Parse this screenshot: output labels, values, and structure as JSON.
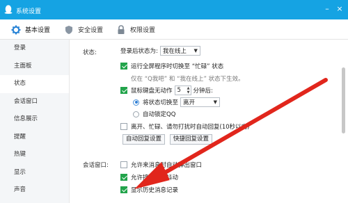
{
  "window": {
    "title": "系统设置",
    "minimize": "–",
    "close": "×"
  },
  "tabs": [
    {
      "label": "基本设置",
      "icon": "gear-icon",
      "active": true
    },
    {
      "label": "安全设置",
      "icon": "shield-icon",
      "active": false
    },
    {
      "label": "权限设置",
      "icon": "lock-icon",
      "active": false
    }
  ],
  "sidebar": {
    "items": [
      {
        "label": "登录"
      },
      {
        "label": "主面板"
      },
      {
        "label": "状态",
        "active": true
      },
      {
        "label": "会话窗口"
      },
      {
        "label": "信息展示"
      },
      {
        "label": "提醒"
      },
      {
        "label": "热键"
      },
      {
        "label": "显示"
      },
      {
        "label": "声音"
      }
    ]
  },
  "status": {
    "section_label": "状态:",
    "login_status_label": "登录后状态为:",
    "login_status_value": "我在线上",
    "fullscreen_busy": {
      "label": "运行全屏程序时切换至 “忙碌” 状态",
      "checked": true
    },
    "hint": "仅在 “Q我吧” 和 “我在线上” 状态下生效。",
    "idle": {
      "label": "鼠标键盘无动作",
      "checked": true,
      "minutes": "5",
      "minutes_suffix": "分钟后:"
    },
    "radio_switch": {
      "label": "将状态切换至",
      "value": "离开",
      "selected": true
    },
    "radio_lock": {
      "label": "自动锁定QQ",
      "selected": false
    },
    "auto_reply": {
      "label": "离开、忙碌、请勿打扰时自动回复(10秒以内)",
      "checked": false
    },
    "auto_reply_settings_btn": "自动回复设置",
    "quick_reply_settings_btn": "快捷回复设置"
  },
  "chat_window": {
    "section_label": "会话窗口:",
    "options": [
      {
        "label": "允许来消息时自动弹出窗口",
        "checked": false
      },
      {
        "label": "允许接收窗口抖动",
        "checked": true
      },
      {
        "label": "显示历史消息记录",
        "checked": true
      }
    ]
  },
  "colors": {
    "titlebar": "#15a3e3",
    "check_green": "#22a44b",
    "annotation_red": "#e1261c"
  }
}
